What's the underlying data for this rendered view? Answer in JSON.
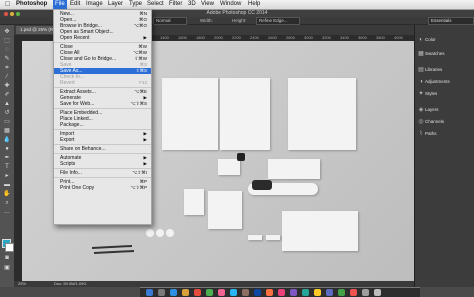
{
  "menubar": {
    "apple": "",
    "app": "Photoshop",
    "items": [
      "File",
      "Edit",
      "Image",
      "Layer",
      "Type",
      "Select",
      "Filter",
      "3D",
      "View",
      "Window",
      "Help"
    ]
  },
  "window": {
    "title": "Adobe Photoshop CC 2014"
  },
  "options": {
    "mode": "Normal",
    "width": "Width:",
    "height": "Height:",
    "refine": "Refine Edge...",
    "workspace": "Essentials"
  },
  "document": {
    "tab": "1.psd @ 25% (RGB/8)"
  },
  "ruler": {
    "ticks": [
      "1400",
      "1600",
      "1800",
      "2000",
      "2200",
      "2400",
      "2600",
      "2800",
      "3000",
      "3200",
      "3400",
      "3600",
      "3800",
      "4000",
      "4200"
    ]
  },
  "status": {
    "zoom": "25%",
    "doc": "Doc: 59.0M/1.09G"
  },
  "panels": [
    {
      "icon": "color-icon",
      "label": "Color"
    },
    {
      "icon": "swatches-icon",
      "label": "Swatches"
    },
    {
      "icon": "libraries-icon",
      "label": "Libraries"
    },
    {
      "icon": "adjustments-icon",
      "label": "Adjustments"
    },
    {
      "icon": "styles-icon",
      "label": "Styles"
    },
    {
      "icon": "layers-icon",
      "label": "Layers"
    },
    {
      "icon": "channels-icon",
      "label": "Channels"
    },
    {
      "icon": "paths-icon",
      "label": "Paths"
    }
  ],
  "file_menu": {
    "new": {
      "label": "New...",
      "shortcut": "⌘N"
    },
    "open": {
      "label": "Open...",
      "shortcut": "⌘O"
    },
    "browse": {
      "label": "Browse in Bridge...",
      "shortcut": "⌥⌘O"
    },
    "open_smart": {
      "label": "Open as Smart Object...",
      "shortcut": ""
    },
    "open_recent": {
      "label": "Open Recent",
      "shortcut": "▶"
    },
    "close": {
      "label": "Close",
      "shortcut": "⌘W"
    },
    "close_all": {
      "label": "Close All",
      "shortcut": "⌥⌘W"
    },
    "close_bridge": {
      "label": "Close and Go to Bridge...",
      "shortcut": "⇧⌘W"
    },
    "save": {
      "label": "Save",
      "shortcut": "⌘S"
    },
    "save_as": {
      "label": "Save As...",
      "shortcut": "⇧⌘S"
    },
    "check_in": {
      "label": "Check In...",
      "shortcut": ""
    },
    "revert": {
      "label": "Revert",
      "shortcut": "F12"
    },
    "extract": {
      "label": "Extract Assets...",
      "shortcut": "⌥⌘E"
    },
    "generate": {
      "label": "Generate",
      "shortcut": "▶"
    },
    "save_web": {
      "label": "Save for Web...",
      "shortcut": "⌥⇧⌘S"
    },
    "place_embedded": {
      "label": "Place Embedded...",
      "shortcut": ""
    },
    "place_linked": {
      "label": "Place Linked...",
      "shortcut": ""
    },
    "package": {
      "label": "Package...",
      "shortcut": ""
    },
    "import": {
      "label": "Import",
      "shortcut": "▶"
    },
    "export": {
      "label": "Export",
      "shortcut": "▶"
    },
    "behance": {
      "label": "Share on Behance...",
      "shortcut": ""
    },
    "automate": {
      "label": "Automate",
      "shortcut": "▶"
    },
    "scripts": {
      "label": "Scripts",
      "shortcut": "▶"
    },
    "file_info": {
      "label": "File Info...",
      "shortcut": "⌥⇧⌘I"
    },
    "print": {
      "label": "Print...",
      "shortcut": "⌘P"
    },
    "print_one": {
      "label": "Print One Copy",
      "shortcut": "⌥⇧⌘P"
    }
  },
  "colors": {
    "highlight": "#2d6fd6",
    "canvas": "#c9c9c9",
    "panel": "#3c3c3c"
  }
}
